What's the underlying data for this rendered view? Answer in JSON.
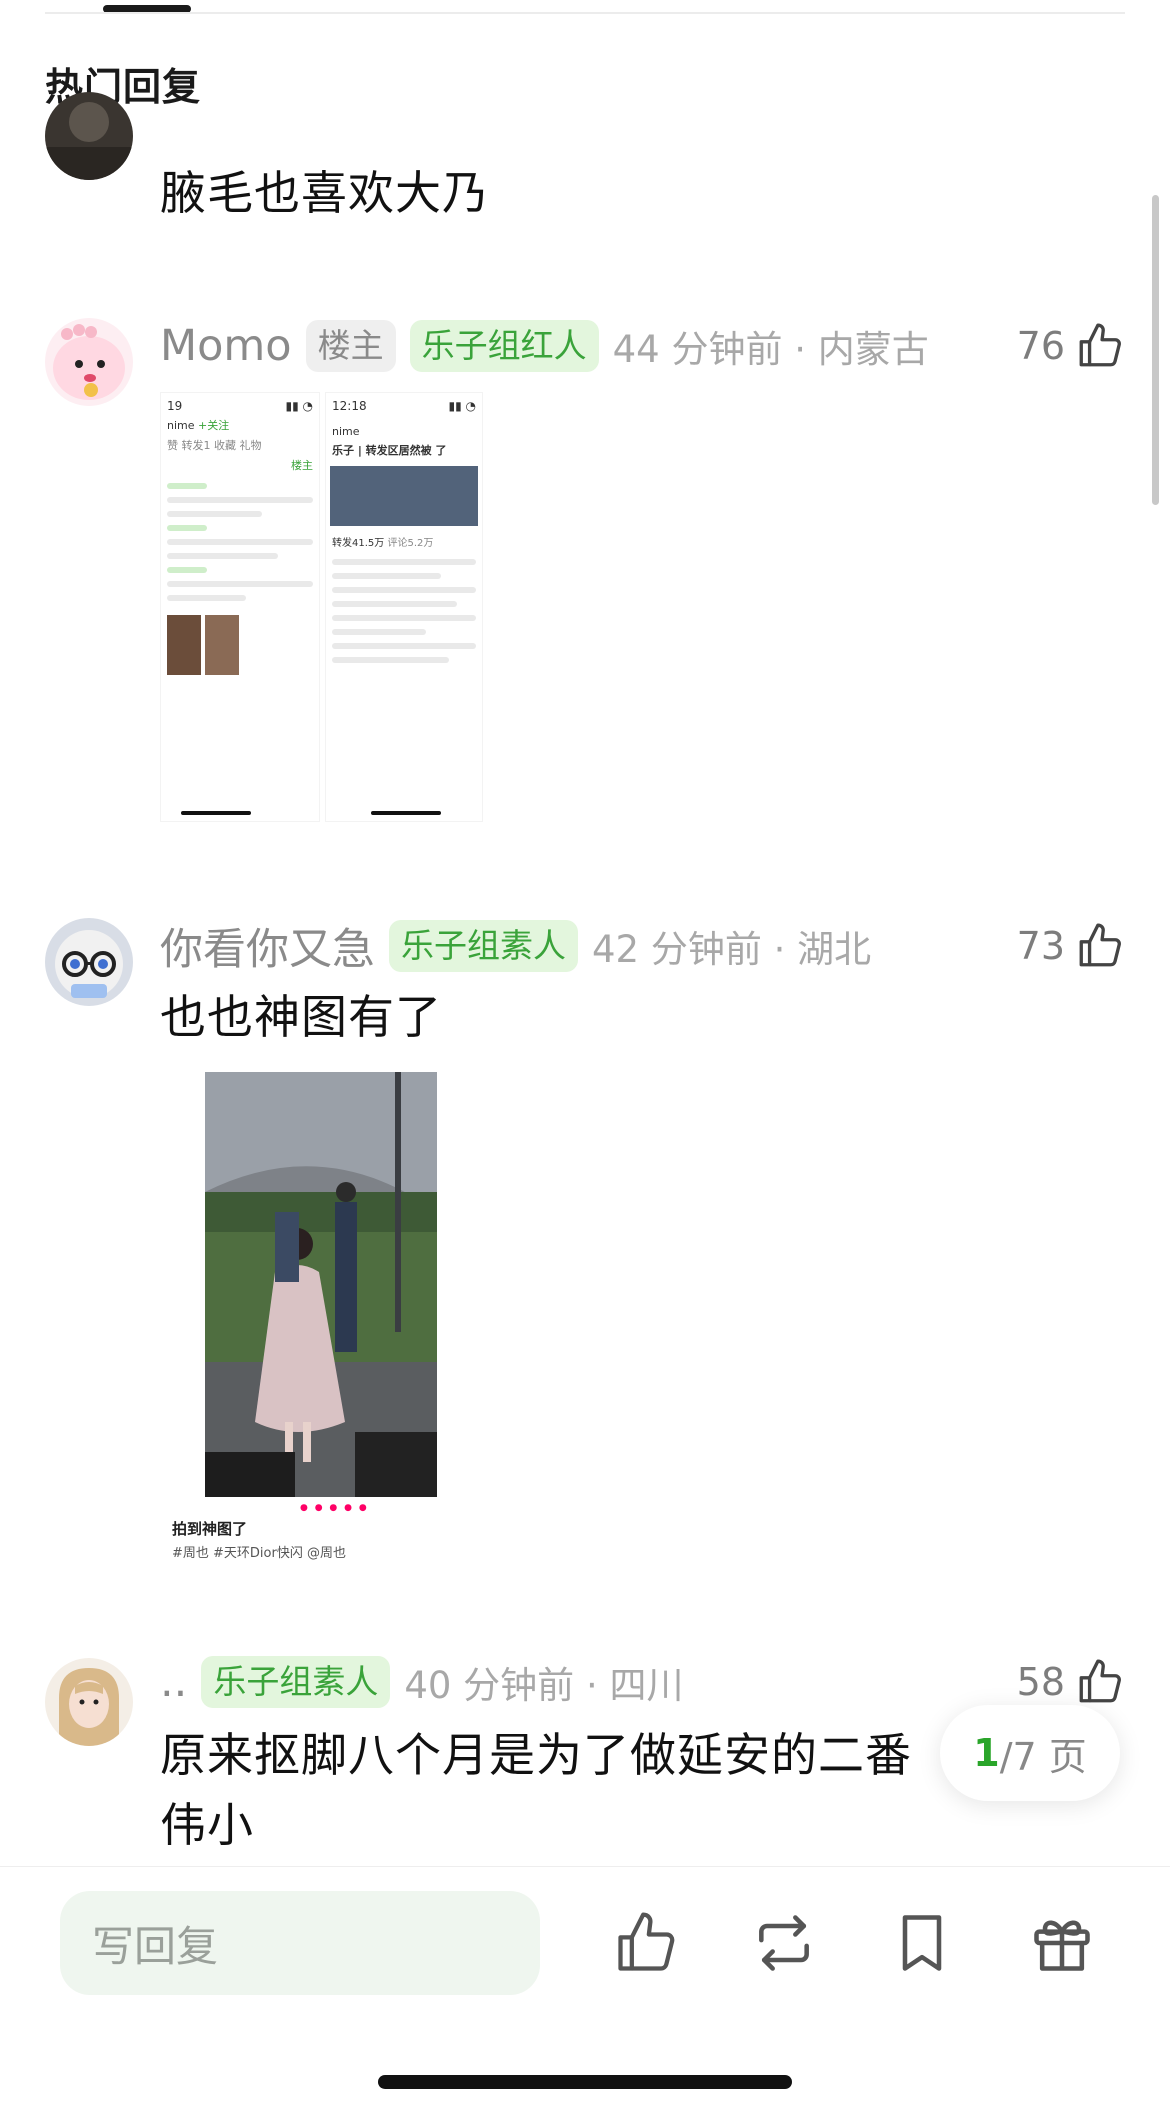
{
  "section": {
    "title": "热门回复"
  },
  "comments": [
    {
      "text": "腋毛也喜欢大乃"
    },
    {
      "username": "Momo",
      "badges": [
        "楼主",
        "乐子组红人"
      ],
      "time_location": "44 分钟前 · 内蒙古",
      "likes": "76",
      "image": {
        "left_screen": {
          "time": "19",
          "nick": "nime",
          "follow": "+关注",
          "tabs": "赞  转发1  收藏  礼物",
          "louzhu": "楼主"
        },
        "right_screen": {
          "time": "12:18",
          "nick": "nime",
          "title": "乐子 | 转发区居然被 了",
          "forward": "转发41.5万",
          "comment": "评论5.2万"
        }
      }
    },
    {
      "username": "你看你又急",
      "badges": [
        "乐子组素人"
      ],
      "time_location": "42 分钟前 · 湖北",
      "likes": "73",
      "text": "也也神图有了",
      "image": {
        "caption": "拍到神图了",
        "tags": "#周也 #天环Dior快闪 @周也"
      }
    },
    {
      "username": "..",
      "badges": [
        "乐子组素人"
      ],
      "time_location": "40 分钟前 · 四川",
      "likes": "58",
      "text_line1": "原来抠脚八个月是为了做延安的二番",
      "text_line2": "伟小"
    }
  ],
  "pager": {
    "current": "1",
    "total": "/7 页"
  },
  "bottom_bar": {
    "reply_placeholder": "写回复"
  },
  "colors": {
    "accent_green": "#3aa33a",
    "badge_green_bg": "#e3f6dd",
    "text_gray": "#8a8a8a"
  }
}
